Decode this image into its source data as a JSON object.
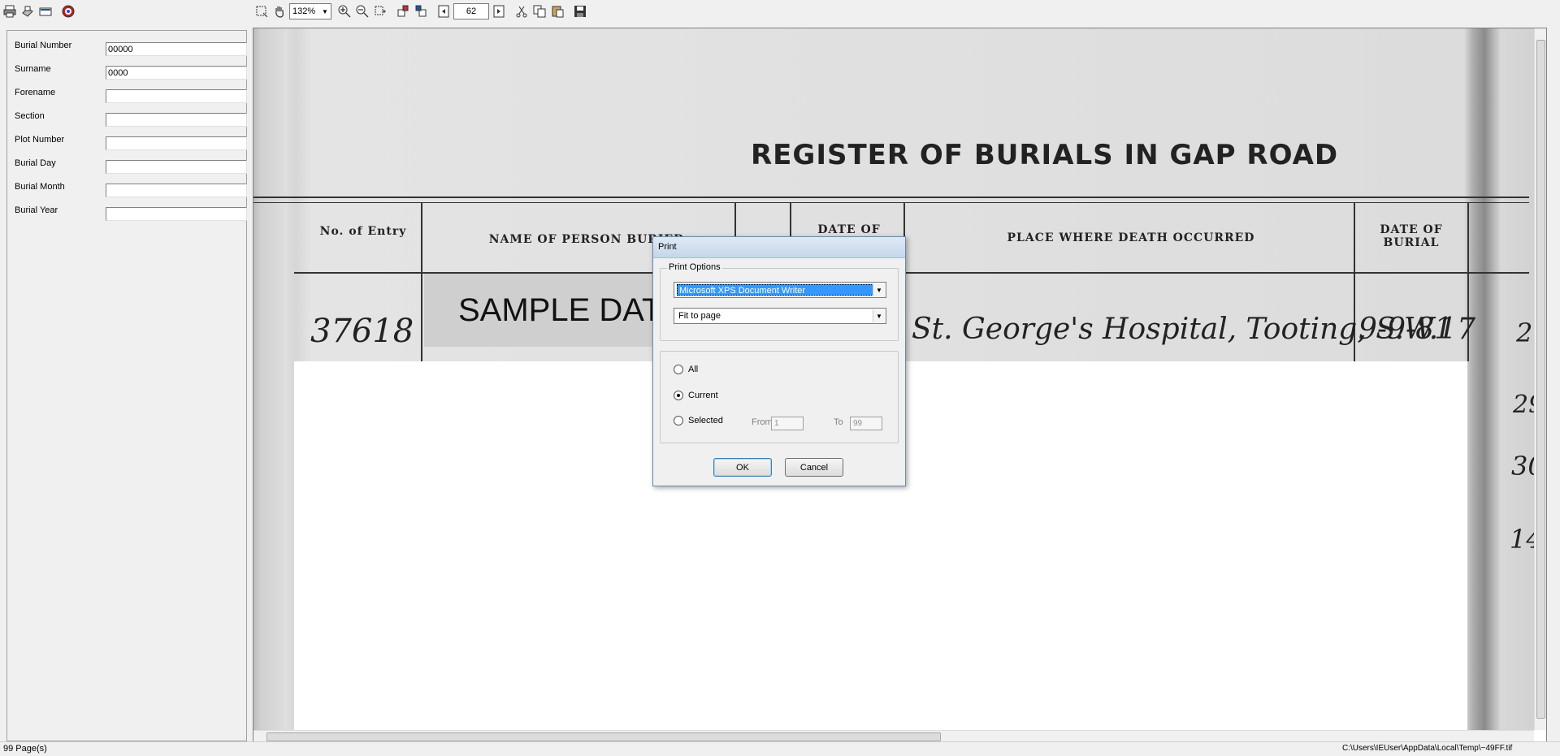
{
  "toolbar_left": {
    "icons": [
      "print-icon",
      "scan-icon",
      "card-icon",
      "help-icon"
    ]
  },
  "toolbar_right": {
    "zoom_value": "132%",
    "page_number": "62"
  },
  "search_form": {
    "fields": [
      {
        "label": "Burial Number",
        "value": "00000"
      },
      {
        "label": "Surname",
        "value": "0000"
      },
      {
        "label": "Forename",
        "value": ""
      },
      {
        "label": "Section",
        "value": ""
      },
      {
        "label": "Plot Number",
        "value": ""
      },
      {
        "label": "Burial Day",
        "value": ""
      },
      {
        "label": "Burial Month",
        "value": ""
      },
      {
        "label": "Burial Year",
        "value": ""
      }
    ]
  },
  "document": {
    "heading": "REGISTER OF BURIALS IN GAP ROAD",
    "col_no_entry": "No. of Entry",
    "col_name": "NAME OF PERSON BURIED",
    "col_date_of": "DATE OF",
    "col_place": "PLACE WHERE DEATH OCCURRED",
    "col_date_burial": "DATE OF BURIAL",
    "entry_number": "37618",
    "watermark": "SAMPLE DATA",
    "place": "St. George's Hospital, Tooting, S.W.17",
    "burial_date": "9-9-81",
    "margin_numbers": [
      "2",
      "29",
      "30",
      "14"
    ]
  },
  "dialog": {
    "title": "Print",
    "options_group": "Print Options",
    "printer": "Microsoft XPS Document Writer",
    "scaling": "Fit to page",
    "range_all": "All",
    "range_current": "Current",
    "range_selected": "Selected",
    "selected_range": "current",
    "from_label": "From",
    "from_value": "1",
    "to_label": "To",
    "to_value": "99",
    "ok": "OK",
    "cancel": "Cancel"
  },
  "status": {
    "pages": "99 Page(s)",
    "path": "C:\\Users\\IEUser\\AppData\\Local\\Temp\\~49FF.tif"
  }
}
